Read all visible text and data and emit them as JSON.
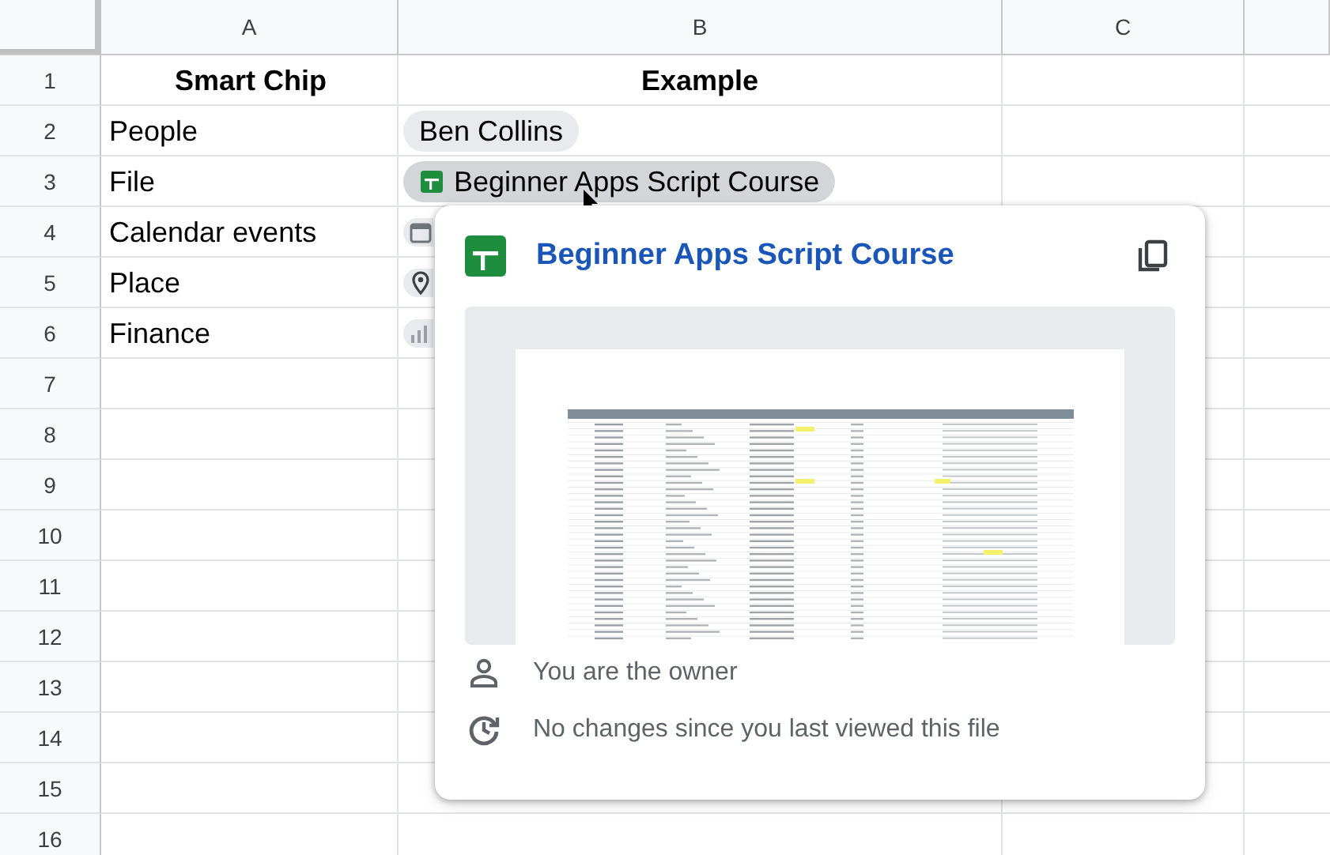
{
  "columns": [
    "A",
    "B",
    "C"
  ],
  "rows": [
    {
      "number": "1",
      "label": "Smart Chip",
      "example": "Example"
    },
    {
      "number": "2",
      "label": "People",
      "chip": {
        "kind": "person",
        "text": "Ben Collins",
        "hovered": false
      }
    },
    {
      "number": "3",
      "label": "File",
      "chip": {
        "kind": "file",
        "text": "Beginner Apps Script Course",
        "hovered": true
      }
    },
    {
      "number": "4",
      "label": "Calendar events",
      "chip": {
        "kind": "calendar",
        "hovered": false
      }
    },
    {
      "number": "5",
      "label": "Place",
      "chip": {
        "kind": "place",
        "hovered": false
      }
    },
    {
      "number": "6",
      "label": "Finance",
      "chip": {
        "kind": "finance",
        "hovered": false
      }
    },
    {
      "number": "7"
    },
    {
      "number": "8"
    },
    {
      "number": "9"
    },
    {
      "number": "10"
    },
    {
      "number": "11"
    },
    {
      "number": "12"
    },
    {
      "number": "13"
    },
    {
      "number": "14"
    },
    {
      "number": "15"
    },
    {
      "number": "16"
    }
  ],
  "popup": {
    "title": "Beginner Apps Script Course",
    "details": [
      {
        "kind": "owner",
        "text": "You are the owner"
      },
      {
        "kind": "history",
        "text": "No changes since you last viewed this file"
      }
    ]
  }
}
